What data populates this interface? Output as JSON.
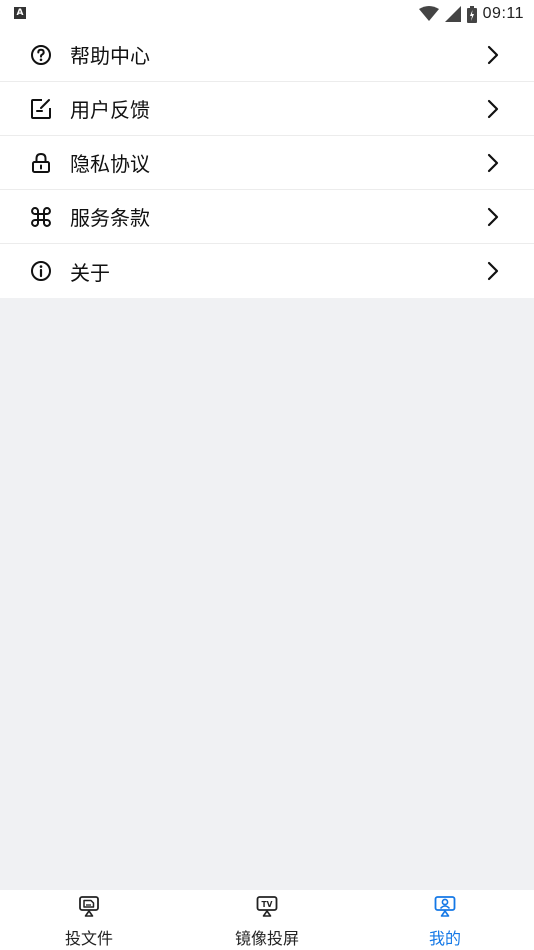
{
  "status_bar": {
    "time": "09:11",
    "app_indicator": "A"
  },
  "menu": {
    "items": [
      {
        "label": "帮助中心",
        "icon": "help-circle-icon"
      },
      {
        "label": "用户反馈",
        "icon": "feedback-edit-icon"
      },
      {
        "label": "隐私协议",
        "icon": "lock-icon"
      },
      {
        "label": "服务条款",
        "icon": "command-icon"
      },
      {
        "label": "关于",
        "icon": "info-icon"
      }
    ]
  },
  "tab_bar": {
    "tabs": [
      {
        "label": "投文件",
        "icon": "cast-file-icon",
        "active": false
      },
      {
        "label": "镜像投屏",
        "icon": "tv-cast-icon",
        "active": false
      },
      {
        "label": "我的",
        "icon": "profile-icon",
        "active": true
      }
    ],
    "active_color": "#1478e6"
  }
}
